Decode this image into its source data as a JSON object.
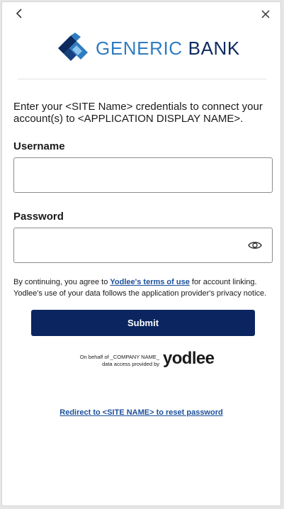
{
  "logo": {
    "word1": "GENERIC",
    "word2": "BANK"
  },
  "intro": "Enter your <SITE Name> credentials to connect your account(s) to <APPLICATION DISPLAY NAME>.",
  "username": {
    "label": "Username",
    "value": "",
    "placeholder": ""
  },
  "password": {
    "label": "Password",
    "value": "",
    "placeholder": ""
  },
  "terms": {
    "prefix": "By continuing, you agree to ",
    "link": "Yodlee's terms of use",
    "suffix": " for account linking. Yodlee's use of your data follows the application provider's privacy notice."
  },
  "submit_label": "Submit",
  "powered": {
    "line1": "On behalf of _COMPANY NAME_",
    "line2": "data access provided by",
    "brand": "yodlee"
  },
  "redirect_link": "Redirect to <SITE NAME> to reset password",
  "colors": {
    "primary_button": "#0b2560",
    "link": "#1b4f9a",
    "logo_light": "#2f7dc0",
    "logo_dark": "#0d2a5e"
  },
  "icons": [
    "chevron-left-icon",
    "close-icon",
    "eye-icon",
    "bank-logo-icon"
  ]
}
